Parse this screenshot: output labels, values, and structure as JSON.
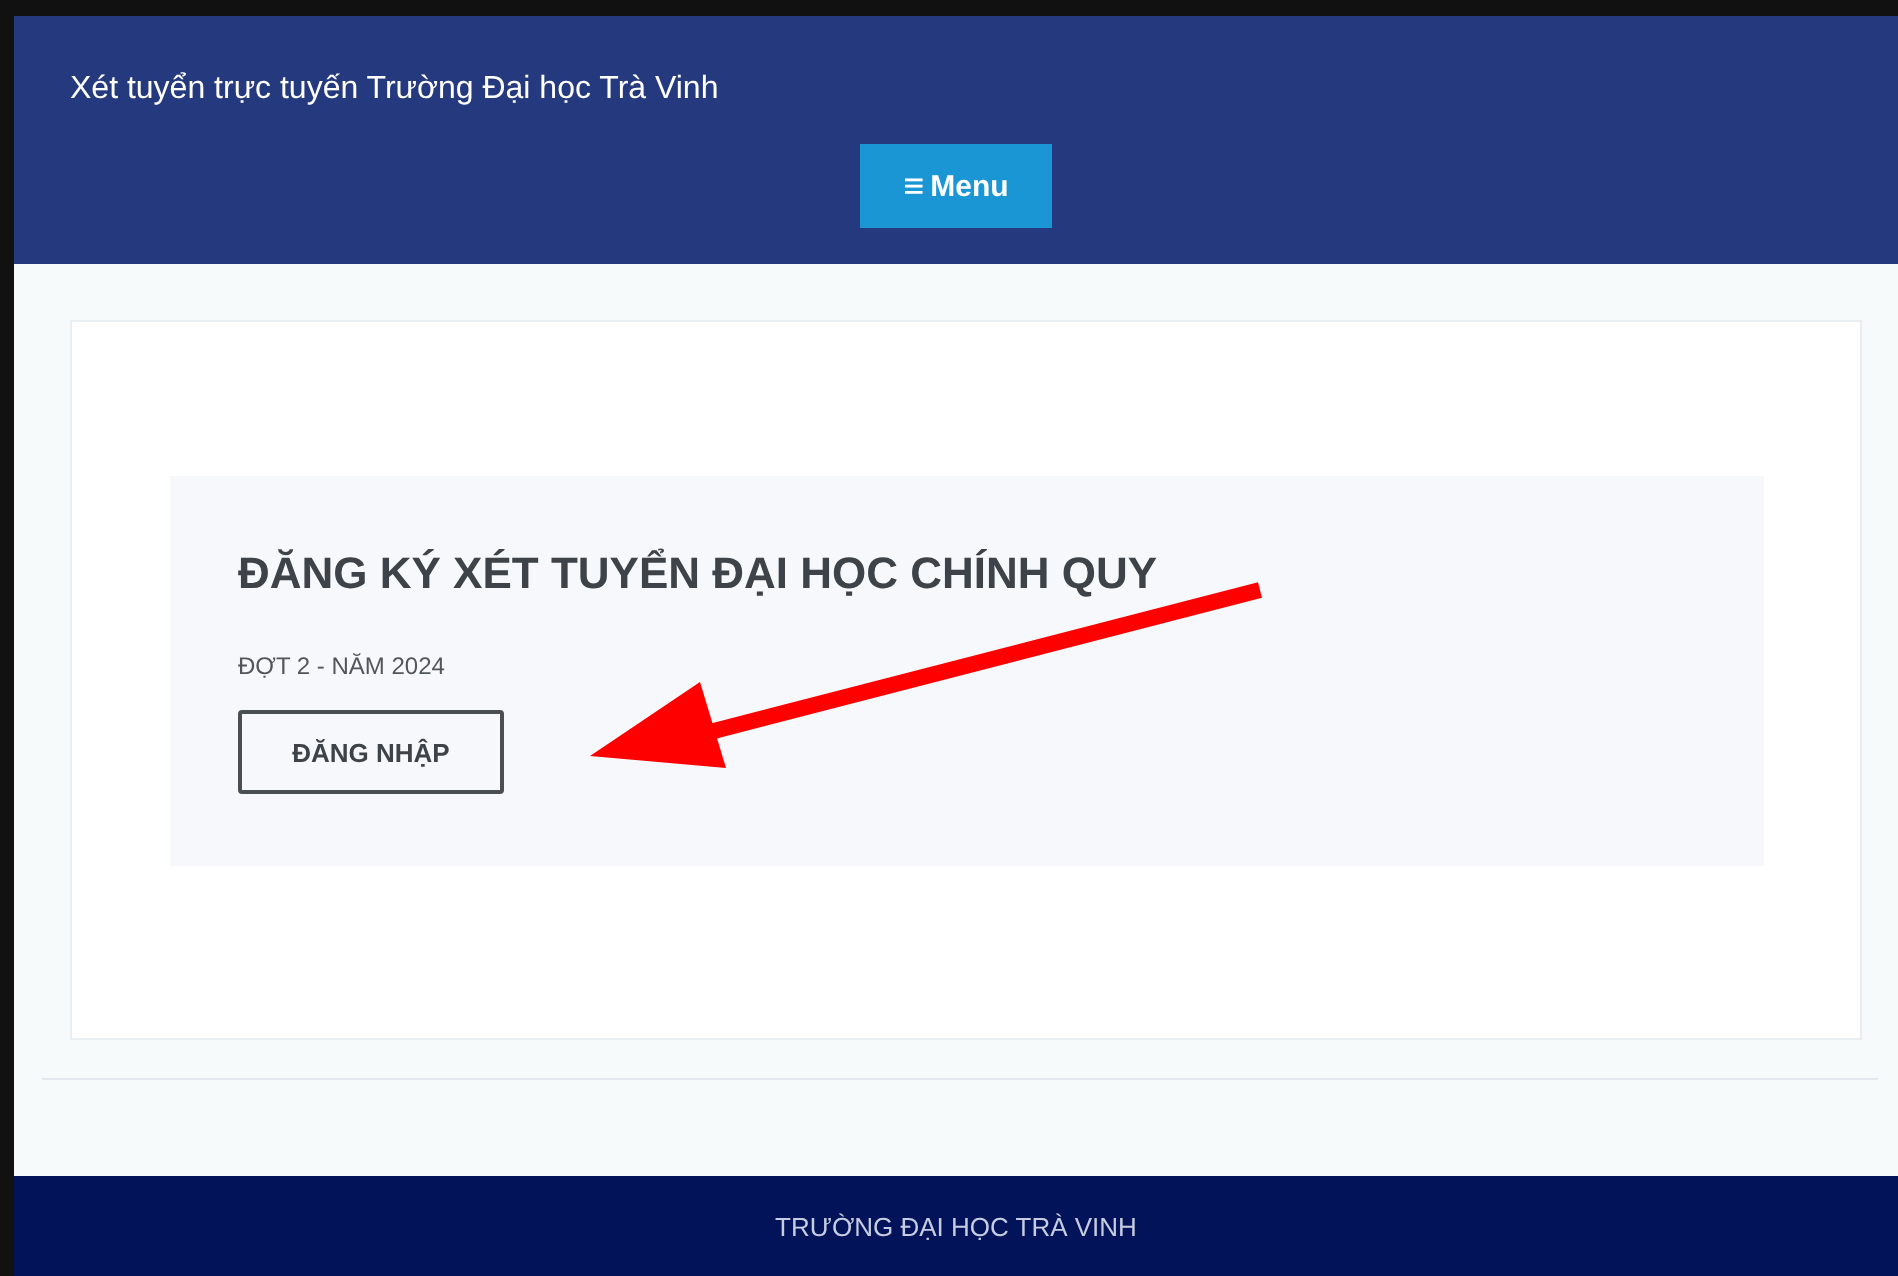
{
  "header": {
    "title": "Xét tuyển trực tuyến Trường Đại học Trà Vinh",
    "menu_button": {
      "icon": "≡",
      "label": "Menu"
    }
  },
  "panel": {
    "heading": "ĐĂNG KÝ XÉT TUYỂN ĐẠI HỌC CHÍNH QUY",
    "subtitle": "ĐỢT 2 - NĂM 2024",
    "button": "ĐĂNG NHẬP"
  },
  "footer": {
    "text": "TRƯỜNG ĐẠI HỌC TRÀ VINH"
  }
}
